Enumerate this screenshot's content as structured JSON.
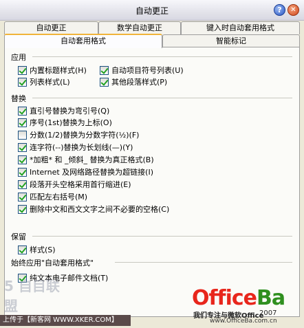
{
  "window": {
    "title": "自动更正"
  },
  "tabs": {
    "row1": [
      "自动更正",
      "数学自动更正",
      "键入时自动套用格式"
    ],
    "row2": [
      "自动套用格式",
      "智能标记"
    ]
  },
  "apply": {
    "heading": "应用",
    "items": [
      {
        "label": "内置标题样式(H)",
        "checked": true
      },
      {
        "label": "自动项目符号列表(U)",
        "checked": true
      },
      {
        "label": "列表样式(L)",
        "checked": true
      },
      {
        "label": "其他段落样式(P)",
        "checked": true
      }
    ]
  },
  "replace": {
    "heading": "替换",
    "items": [
      {
        "label": "直引号替换为弯引号(Q)",
        "checked": true
      },
      {
        "label": "序号(1st)替换为上标(O)",
        "checked": true
      },
      {
        "label": "分数(1/2)替换为分数字符(½)(F)",
        "checked": false
      },
      {
        "label": "连字符(--)替换为长划线(—)(Y)",
        "checked": true
      },
      {
        "label": "*加粗* 和 _倾斜_ 替换为真正格式(B)",
        "checked": true
      },
      {
        "label": "Internet 及网络路径替换为超链接(I)",
        "checked": true
      },
      {
        "label": "段落开头空格采用首行缩进(E)",
        "checked": true
      },
      {
        "label": "匹配左右括号(M)",
        "checked": true
      },
      {
        "label": "删除中文和西文文字之间不必要的空格(C)",
        "checked": true
      }
    ]
  },
  "preserve": {
    "heading": "保留",
    "items": [
      {
        "label": "样式(S)",
        "checked": true
      }
    ]
  },
  "always_apply": {
    "heading": "始终应用\"自动套用格式\"",
    "items": [
      {
        "label": "纯文本电子邮件文档(T)",
        "checked": true
      }
    ]
  },
  "overlay": {
    "upload_text": "上传于【新客网 WWW.XKER.COM】",
    "watermark_left": "5 自目联盟",
    "logo_part1": "Office",
    "logo_part2": "Ba",
    "logo_slogan": "我们专注与微软Office",
    "logo_year": "2007",
    "logo_url": "www.OfficeBa.com.cn"
  }
}
